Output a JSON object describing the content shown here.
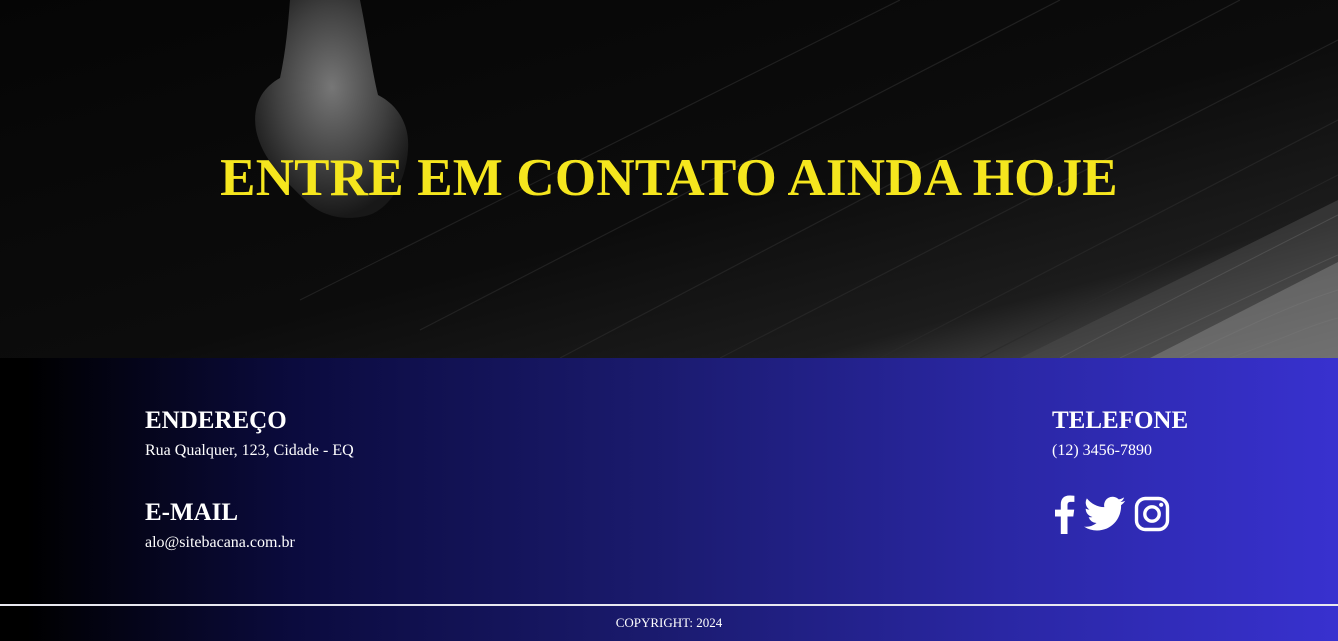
{
  "hero": {
    "title": "ENTRE EM CONTATO AINDA HOJE"
  },
  "footer": {
    "address": {
      "heading": "ENDEREÇO",
      "value": "Rua Qualquer, 123, Cidade - EQ"
    },
    "email": {
      "heading": "E-MAIL",
      "value": "alo@sitebacana.com.br"
    },
    "phone": {
      "heading": "TELEFONE",
      "value": "(12) 3456-7890"
    },
    "social": [
      "facebook-icon",
      "twitter-icon",
      "instagram-icon"
    ],
    "copyright": "COPYRIGHT: 2024"
  },
  "colors": {
    "hero_title": "#f5e61e",
    "gradient_end": "#3831cf"
  }
}
